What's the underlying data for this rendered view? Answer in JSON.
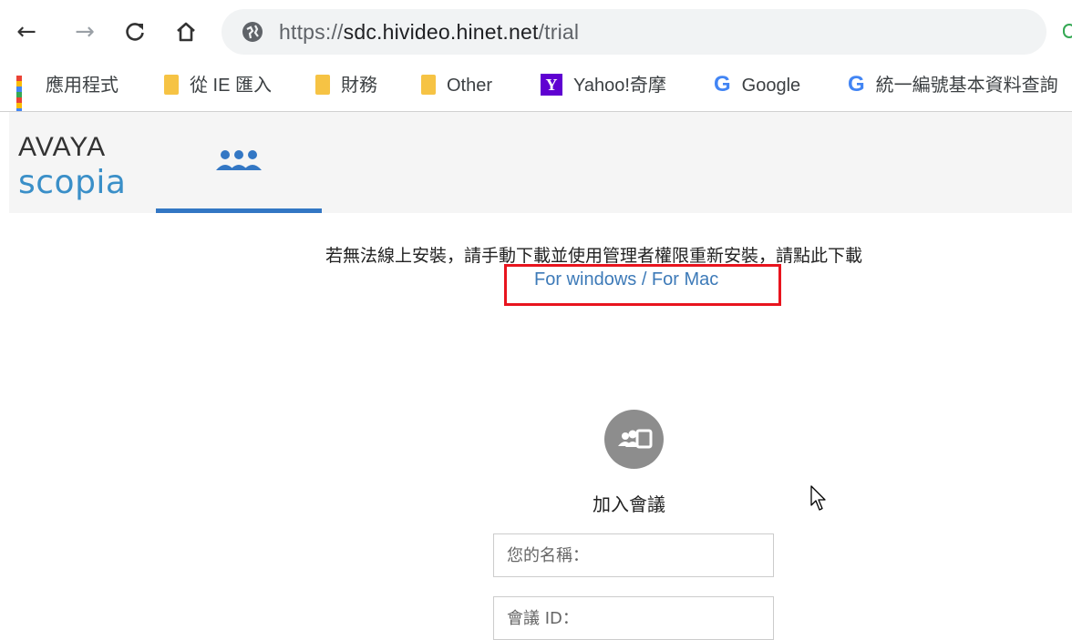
{
  "browser": {
    "url_scheme": "https://",
    "url_host": "sdc.hivideo.hinet.net",
    "url_path": "/trial",
    "bookmarks": [
      {
        "label": "應用程式",
        "icon": "apps-grid-icon"
      },
      {
        "label": "從 IE 匯入",
        "icon": "folder-icon"
      },
      {
        "label": "財務",
        "icon": "folder-icon"
      },
      {
        "label": "Other",
        "icon": "folder-icon"
      },
      {
        "label": "Yahoo!奇摩",
        "icon": "yahoo-icon"
      },
      {
        "label": "Google",
        "icon": "google-icon"
      },
      {
        "label": "統一編號基本資料查詢",
        "icon": "google-icon"
      }
    ]
  },
  "header": {
    "logo_line1": "AVAYA",
    "logo_line2": "scopia",
    "tab_icon": "people-group-icon",
    "accent_color": "#3377c4"
  },
  "main": {
    "notice": "若無法線上安裝，請手動下載並使用管理者權限重新安裝，請點此下載",
    "download_links": "For windows / For Mac",
    "join_icon": "join-meeting-icon",
    "join_title": "加入會議",
    "name_placeholder": "您的名稱：",
    "meeting_id_placeholder": "會議 ID："
  }
}
